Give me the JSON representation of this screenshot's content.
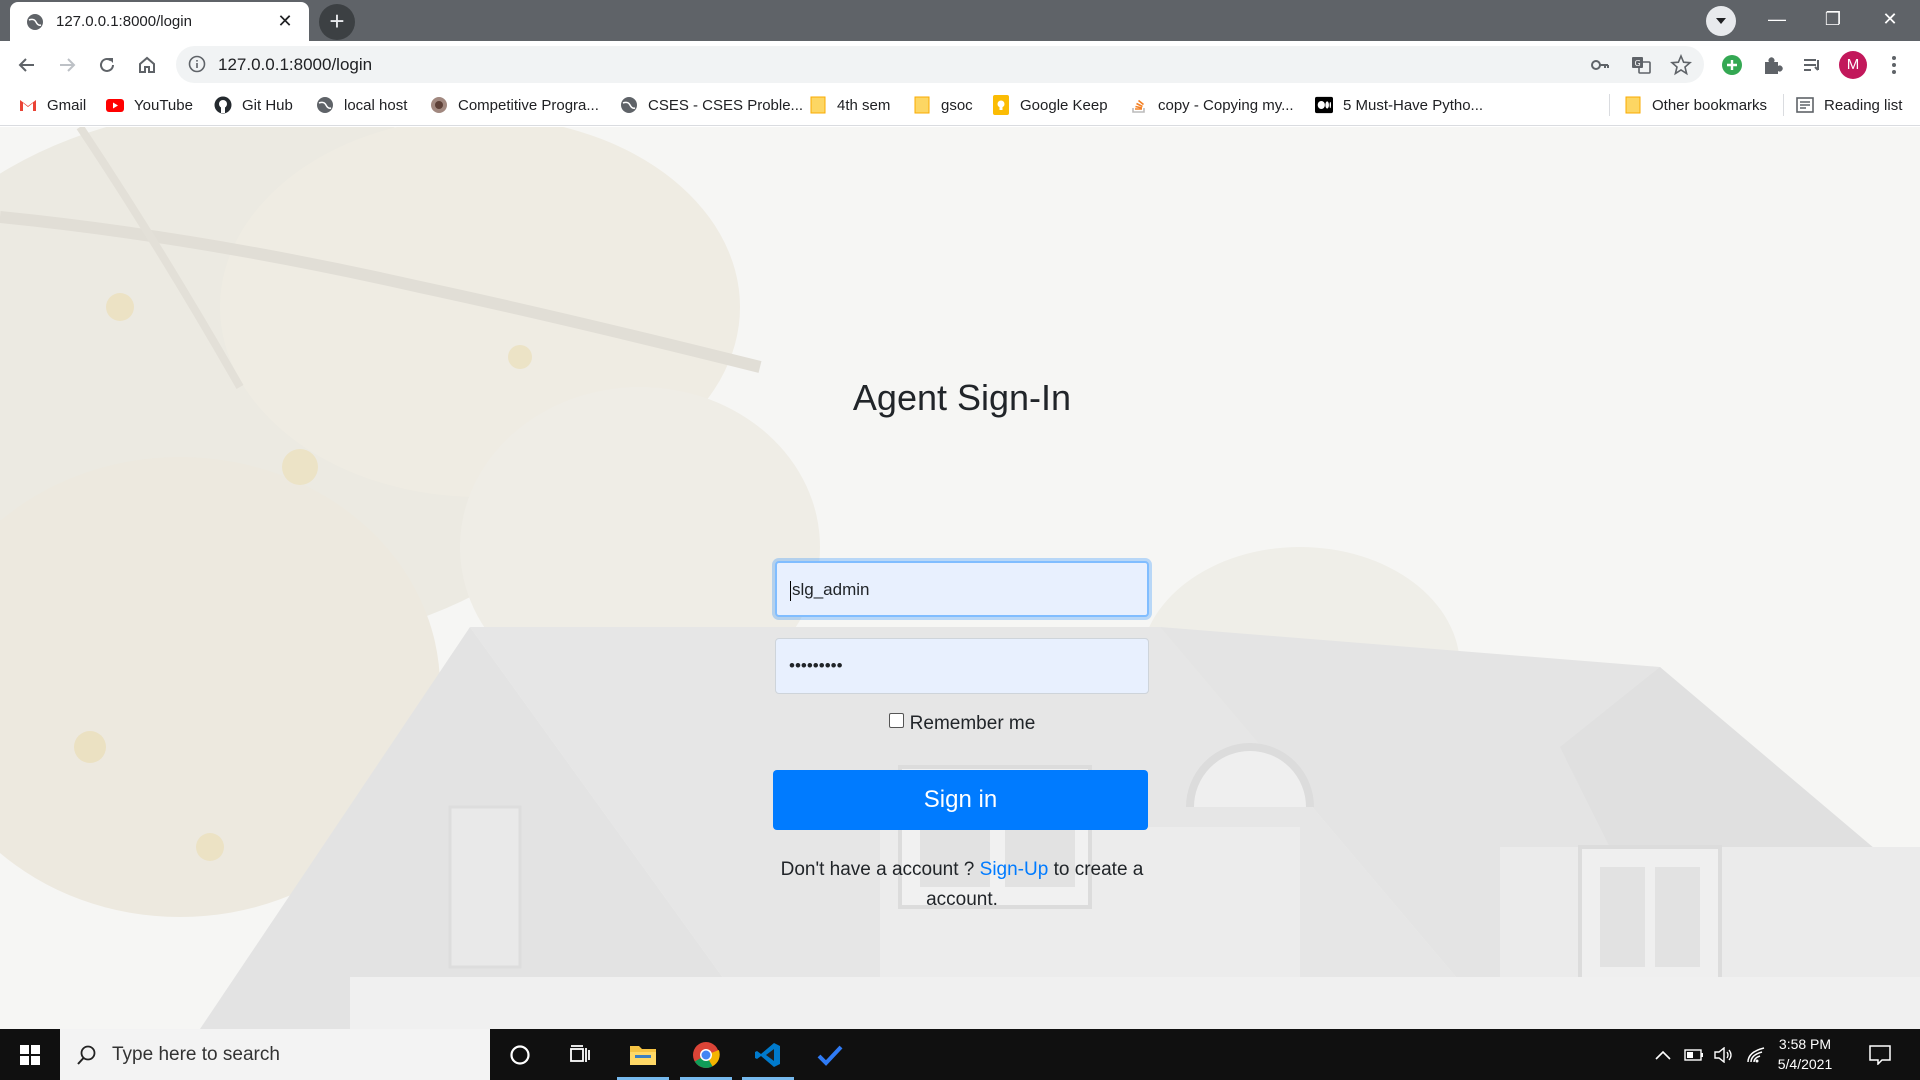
{
  "browser": {
    "tab_title": "127.0.0.1:8000/login",
    "url": "127.0.0.1:8000/login",
    "profile_initial": "M",
    "window_controls": {
      "minimize": "—",
      "restore": "❐",
      "close": "✕"
    }
  },
  "bookmarks": [
    {
      "label": "Gmail",
      "icon": "gmail-icon"
    },
    {
      "label": "YouTube",
      "icon": "youtube-icon"
    },
    {
      "label": "Git Hub",
      "icon": "github-icon"
    },
    {
      "label": "local host",
      "icon": "globe-icon"
    },
    {
      "label": "Competitive Progra...",
      "icon": "site-icon"
    },
    {
      "label": "CSES - CSES Proble...",
      "icon": "globe-icon"
    },
    {
      "label": "4th sem",
      "icon": "folder-icon"
    },
    {
      "label": "gsoc",
      "icon": "folder-icon"
    },
    {
      "label": "Google Keep",
      "icon": "keep-icon"
    },
    {
      "label": "copy - Copying my...",
      "icon": "stackoverflow-icon"
    },
    {
      "label": "5 Must-Have Pytho...",
      "icon": "medium-icon"
    }
  ],
  "bookmarks_right": {
    "other_bookmarks": "Other bookmarks",
    "reading_list": "Reading list"
  },
  "login": {
    "title": "Agent Sign-In",
    "username_value": "slg_admin",
    "password_mask": "•••••••••",
    "remember_label": "Remember me",
    "signin_label": "Sign in",
    "signup_prefix": "Don't have a account ? ",
    "signup_link": "Sign-Up",
    "signup_suffix": " to create a account."
  },
  "taskbar": {
    "search_placeholder": "Type here to search",
    "time": "3:58 PM",
    "date": "5/4/2021"
  },
  "colors": {
    "primary": "#007bff",
    "autofill": "#e8f0fe",
    "chrome_dark": "#5f6368"
  }
}
